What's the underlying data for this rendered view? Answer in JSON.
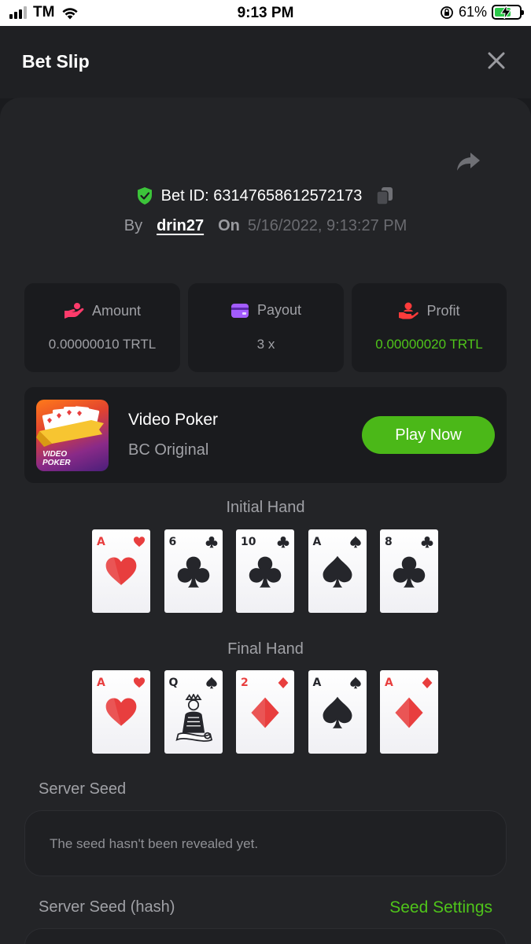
{
  "status_bar": {
    "carrier": "TM",
    "time": "9:13 PM",
    "battery_percent": "61%"
  },
  "header": {
    "title": "Bet Slip"
  },
  "bet": {
    "id_text": "Bet ID: 63147658612572173",
    "by_label": "By",
    "username": "drin27",
    "on_label": "On",
    "date": "5/16/2022, 9:13:27 PM"
  },
  "stats": [
    {
      "label": "Amount",
      "value": "0.00000010 TRTL",
      "icon": "hand-coin-icon",
      "color": "#ff3b6b"
    },
    {
      "label": "Payout",
      "value": "3 x",
      "icon": "wallet-icon",
      "color": "#a35cff"
    },
    {
      "label": "Profit",
      "value": "0.00000020 TRTL",
      "icon": "hand-person-icon",
      "color": "#ff3b3b"
    }
  ],
  "game": {
    "name": "Video Poker",
    "subtitle": "BC Original",
    "thumb_text": "VIDEO\nPOKER",
    "play_label": "Play Now"
  },
  "initial_hand": {
    "title": "Initial Hand",
    "cards": [
      {
        "rank": "A",
        "suit": "hearts"
      },
      {
        "rank": "6",
        "suit": "clubs"
      },
      {
        "rank": "10",
        "suit": "clubs"
      },
      {
        "rank": "A",
        "suit": "spades"
      },
      {
        "rank": "8",
        "suit": "clubs"
      }
    ]
  },
  "final_hand": {
    "title": "Final Hand",
    "cards": [
      {
        "rank": "A",
        "suit": "hearts"
      },
      {
        "rank": "Q",
        "suit": "spades"
      },
      {
        "rank": "2",
        "suit": "diamonds"
      },
      {
        "rank": "A",
        "suit": "spades"
      },
      {
        "rank": "A",
        "suit": "diamonds"
      }
    ]
  },
  "server_seed": {
    "label": "Server Seed",
    "value": "The seed hasn't been revealed yet."
  },
  "server_seed_hash": {
    "label": "Server Seed (hash)",
    "settings_label": "Seed Settings"
  },
  "colors": {
    "accent_green": "#4bb818",
    "profit_green": "#4fc41a",
    "card_red": "#e83e3e"
  }
}
